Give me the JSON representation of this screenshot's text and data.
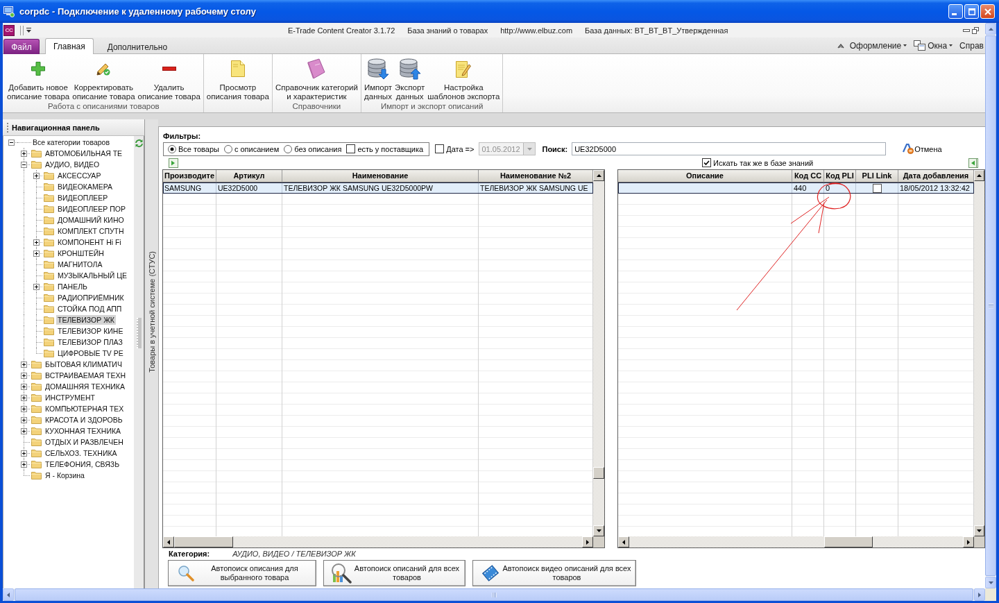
{
  "window": {
    "title": "corpdc - Подключение к удаленному рабочему столу"
  },
  "app_bar": {
    "logo": "CC",
    "info": [
      "E-Trade Content Creator 3.1.72",
      "База знаний о товарах",
      "http://www.elbuz.com",
      "База данных: BT_BT_BT_Утвержденная"
    ]
  },
  "ribbon_tabs": [
    {
      "label": "Файл",
      "kind": "file",
      "selected": false
    },
    {
      "label": "Главная",
      "kind": "tab",
      "selected": true
    },
    {
      "label": "Дополнительно",
      "kind": "tab",
      "selected": false
    }
  ],
  "ribbon_menu": [
    {
      "label": "Оформление",
      "kind": "dropdown"
    },
    {
      "label": "Окна",
      "kind": "windows"
    },
    {
      "label": "Справ",
      "kind": "plain"
    }
  ],
  "ribbon_groups": [
    {
      "label": "Работа с описаниями товаров",
      "buttons": [
        {
          "kind": "add",
          "label": "Добавить новое\nописание товара"
        },
        {
          "kind": "edit",
          "label": "Корректировать\nописание товара"
        },
        {
          "kind": "delete",
          "label": "Удалить\nописание товара"
        }
      ]
    },
    {
      "buttons": [
        {
          "kind": "view",
          "label": "Просмотр\nописания товара"
        }
      ]
    },
    {
      "label": "Справочники",
      "buttons": [
        {
          "kind": "catalog",
          "label": "Справочник категорий\nи характеристик"
        }
      ]
    },
    {
      "label": "Импорт и экспорт описаний",
      "buttons": [
        {
          "kind": "import",
          "label": "Импорт\nданных"
        },
        {
          "kind": "export",
          "label": "Экспорт\nданных"
        },
        {
          "kind": "templates",
          "label": "Настройка\nшаблонов экспорта"
        }
      ]
    }
  ],
  "nav_panel": {
    "title": "Навигационная панель",
    "tree": {
      "label": "Все категории товаров",
      "expanded": true,
      "selected": false,
      "children": [
        {
          "label": "АВТОМОБИЛЬНАЯ ТЕ",
          "expanded": false,
          "selected": false
        },
        {
          "label": "АУДИО, ВИДЕО",
          "expanded": true,
          "selected": false,
          "children": [
            {
              "label": "АКСЕССУАР",
              "expanded": false,
              "selected": false
            },
            {
              "label": "ВИДЕОКАМЕРА",
              "selected": false
            },
            {
              "label": "ВИДЕОПЛЕЕР",
              "selected": false
            },
            {
              "label": "ВИДЕОПЛЕЕР ПОР",
              "selected": false
            },
            {
              "label": "ДОМАШНИЙ КИНО",
              "selected": false
            },
            {
              "label": "КОМПЛЕКТ СПУТН",
              "selected": false
            },
            {
              "label": "КОМПОНЕНТ Hi Fi",
              "expanded": false,
              "selected": false
            },
            {
              "label": "КРОНШТЕЙН",
              "expanded": false,
              "selected": false
            },
            {
              "label": "МАГНИТОЛА",
              "selected": false
            },
            {
              "label": "МУЗЫКАЛЬНЫЙ ЦЕ",
              "selected": false
            },
            {
              "label": "ПАНЕЛЬ",
              "expanded": false,
              "selected": false
            },
            {
              "label": "РАДИОПРИЁМНИК",
              "selected": false
            },
            {
              "label": "СТОЙКА ПОД АПП",
              "selected": false
            },
            {
              "label": "ТЕЛЕВИЗОР ЖК",
              "selected": true
            },
            {
              "label": "ТЕЛЕВИЗОР КИНЕ",
              "selected": false
            },
            {
              "label": "ТЕЛЕВИЗОР ПЛАЗ",
              "selected": false
            },
            {
              "label": "ЦИФРОВЫЕ TV РЕ",
              "selected": false
            }
          ]
        },
        {
          "label": "БЫТОВАЯ КЛИМАТИЧ",
          "expanded": false,
          "selected": false
        },
        {
          "label": "ВСТРАИВАЕМАЯ ТЕХН",
          "expanded": false,
          "selected": false
        },
        {
          "label": "ДОМАШНЯЯ ТЕХНИКА",
          "expanded": false,
          "selected": false
        },
        {
          "label": "ИНСТРУМЕНТ",
          "expanded": false,
          "selected": false
        },
        {
          "label": "КОМПЬЮТЕРНАЯ ТЕХ",
          "expanded": false,
          "selected": false
        },
        {
          "label": "КРАСОТА И ЗДОРОВЬ",
          "expanded": false,
          "selected": false
        },
        {
          "label": "КУХОННАЯ ТЕХНИКА",
          "expanded": false,
          "selected": false
        },
        {
          "label": "ОТДЫХ И РАЗВЛЕЧЕН",
          "selected": false
        },
        {
          "label": "СЕЛЬХОЗ. ТЕХНИКА",
          "expanded": false,
          "selected": false
        },
        {
          "label": "ТЕЛЕФОНИЯ, СВЯЗЬ",
          "expanded": false,
          "selected": false
        },
        {
          "label": "Я - Корзина",
          "selected": false
        }
      ]
    }
  },
  "side_tab": {
    "label": "Товары в учетной системе (СТУС)"
  },
  "filters": {
    "title": "Фильтры:",
    "radios": [
      {
        "label": "Все товары",
        "selected": true
      },
      {
        "label": "с описанием",
        "selected": false
      },
      {
        "label": "без описания",
        "selected": false
      }
    ],
    "supplier": {
      "label": "есть у поставщика",
      "checked": false
    },
    "date": {
      "label": "Дата =>",
      "checked": false,
      "value": "01.05.2012",
      "disabled": true
    },
    "search": {
      "label": "Поиск:",
      "value": "UE32D5000"
    },
    "cancel": "Отмена",
    "knowledge": {
      "label": "Искать так же в базе знаний",
      "checked": true
    }
  },
  "products_table": {
    "columns": [
      "Производите",
      "Артикул",
      "Наименование",
      "Наименование №2"
    ],
    "rows": [
      {
        "selected": true,
        "cells": [
          "SAMSUNG",
          "UE32D5000",
          "ТЕЛЕВИЗОР ЖК SAMSUNG UE32D5000PW",
          "ТЕЛЕВИЗОР ЖК SAMSUNG UE"
        ]
      }
    ]
  },
  "descriptions_table": {
    "columns": [
      "Описание",
      "Код CC",
      "Код PLI",
      "PLI Link",
      "Дата добавления"
    ],
    "rows": [
      {
        "selected": true,
        "code_cc": "440",
        "code_pli": "0",
        "pli_link": false,
        "date_added": "18/05/2012 13:32:42"
      }
    ]
  },
  "category": {
    "label": "Категория:",
    "value": "АУДИО, ВИДЕО / ТЕЛЕВИЗОР ЖК"
  },
  "action_buttons": [
    {
      "kind": "search",
      "label": "Автопоиск описания для\nвыбранного товара"
    },
    {
      "kind": "chart-search",
      "label": "Автопоиск описаний для всех\nтоваров"
    },
    {
      "kind": "video",
      "label": "Автопоиск видео описаний для всех\nтоваров"
    }
  ]
}
